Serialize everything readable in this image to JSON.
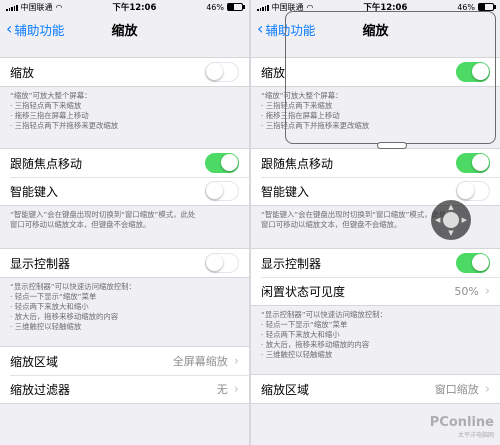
{
  "left": {
    "status": {
      "carrier": "中国联通",
      "time": "下午12:06",
      "battery": "46%"
    },
    "nav": {
      "back_label": "辅助功能",
      "title": "缩放"
    },
    "zoom_row": {
      "label": "缩放",
      "on": false
    },
    "zoom_note": [
      "“缩放”可放大整个屏幕：",
      "· 三指轻点两下来缩放",
      "· 拖移三指在屏幕上移动",
      "· 三指轻点两下并拖移来更改缩放"
    ],
    "follow_focus": {
      "label": "跟随焦点移动",
      "on": true
    },
    "smart_typing": {
      "label": "智能键入",
      "on": false
    },
    "smart_note": [
      "“智能键入”会在键盘出现时切换到“窗口缩放”模式，此处",
      "窗口可移动以缩放文本，但键盘不会缩放。"
    ],
    "show_controller": {
      "label": "显示控制器",
      "on": false
    },
    "controller_note": [
      "“显示控制器”可以快速访问缩放控制：",
      "· 轻点一下显示“缩放”菜单",
      "· 轻点两下来放大和缩小",
      "· 放大后，拖移来移动缩放的内容",
      "· 三维触控以轻触缩放"
    ],
    "zoom_region": {
      "label": "缩放区域",
      "value": "全屏幕缩放"
    },
    "zoom_filter": {
      "label": "缩放过滤器",
      "value": "无"
    }
  },
  "right": {
    "status": {
      "carrier": "中国联通",
      "time": "下午12:06",
      "battery": "46%"
    },
    "nav": {
      "back_label": "辅助功能",
      "title": "缩放"
    },
    "zoom_row": {
      "label": "缩放",
      "on": true
    },
    "zoom_note": [
      "“缩放”可放大整个屏幕：",
      "· 三指轻点两下来缩放",
      "· 拖移三指在屏幕上移动",
      "· 三指轻点两下并拖移来更改缩放"
    ],
    "follow_focus": {
      "label": "跟随焦点移动",
      "on": true
    },
    "smart_typing": {
      "label": "智能键入",
      "on": false
    },
    "smart_note": [
      "“智能键入”会在键盘出现时切换到“窗口缩放”模式，此处",
      "窗口可移动以缩放文本，但键盘不会缩放。"
    ],
    "show_controller": {
      "label": "显示控制器",
      "on": true
    },
    "idle_visibility": {
      "label": "闲置状态可见度",
      "value": "50%"
    },
    "controller_note": [
      "“显示控制器”可以快速访问缩放控制：",
      "· 轻点一下显示“缩放”菜单",
      "· 轻点两下来放大和缩小",
      "· 放大后，拖移来移动缩放的内容",
      "· 三维触控以轻触缩放"
    ],
    "zoom_region": {
      "label": "缩放区域",
      "value": "窗口缩放"
    }
  },
  "watermark": {
    "line1": "PConline",
    "line2": "太平洋电脑网"
  },
  "colors": {
    "accent": "#0a7cff",
    "toggle_on": "#4cd964",
    "background": "#efeff4"
  }
}
